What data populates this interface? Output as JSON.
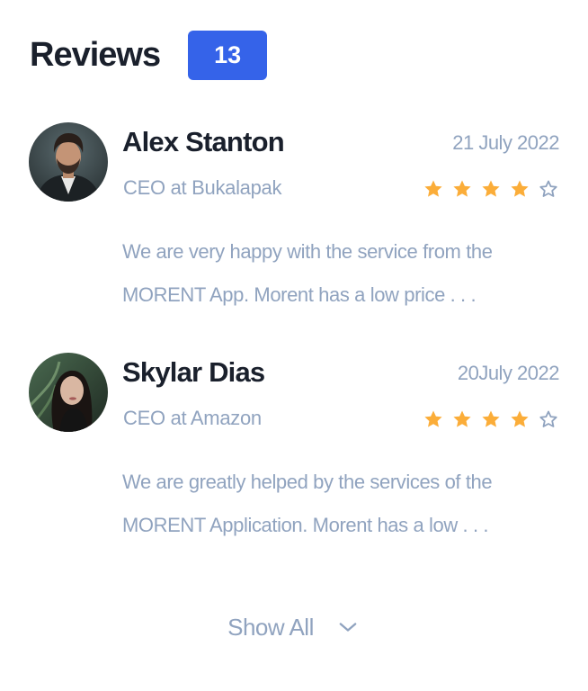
{
  "section": {
    "title": "Reviews",
    "count": "13"
  },
  "reviews": [
    {
      "name": "Alex Stanton",
      "role": "CEO at Bukalapak",
      "date": "21 July 2022",
      "rating": 4,
      "max_rating": 5,
      "text": "We are very happy with the service from the MORENT App. Morent has a low price . . ."
    },
    {
      "name": "Skylar Dias",
      "role": "CEO at Amazon",
      "date": "20July 2022",
      "rating": 4,
      "max_rating": 5,
      "text": "We are greatly helped by the services of the MORENT Application. Morent has a low . . ."
    }
  ],
  "footer": {
    "show_all_label": "Show All"
  },
  "colors": {
    "accent": "#3563e9",
    "star_filled": "#fbad39",
    "muted_text": "#90a3bf",
    "heading_text": "#1a202c"
  },
  "icons": {
    "star_filled": "star-filled-icon",
    "star_empty": "star-outline-icon",
    "expand": "chevron-down-icon"
  }
}
